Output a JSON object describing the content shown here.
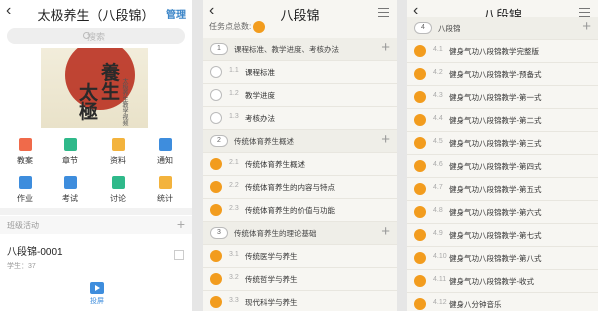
{
  "p1": {
    "title": "太极养生（八段锦）",
    "manage": "管理",
    "search_placeholder": "搜索",
    "cover": {
      "c1": "太\n極",
      "c2": "養\n生",
      "c3": "太极养生教学视频"
    },
    "grid": [
      {
        "label": "教案",
        "color": "#f06a4a"
      },
      {
        "label": "章节",
        "color": "#2fb98a"
      },
      {
        "label": "资料",
        "color": "#f3b33d"
      },
      {
        "label": "通知",
        "color": "#3e8ddd"
      },
      {
        "label": "作业",
        "color": "#3e8ddd"
      },
      {
        "label": "考试",
        "color": "#3e8ddd"
      },
      {
        "label": "讨论",
        "color": "#2fb98a"
      },
      {
        "label": "统计",
        "color": "#f3b33d"
      }
    ],
    "section": "班级活动",
    "class_name": "八段锦-0001",
    "students": "学生：37",
    "projection": "投屏"
  },
  "p2": {
    "title": "八段锦",
    "tasks_label": "任务点总数:",
    "rows": [
      {
        "type": "chapter",
        "num": "1",
        "text": "课程标准、教学进度、考核办法"
      },
      {
        "type": "lesson",
        "num": "1.1",
        "text": "课程标准",
        "dot": "empty"
      },
      {
        "type": "lesson",
        "num": "1.2",
        "text": "教学进度",
        "dot": "empty"
      },
      {
        "type": "lesson",
        "num": "1.3",
        "text": "考核办法",
        "dot": "empty"
      },
      {
        "type": "chapter",
        "num": "2",
        "text": "传统体育养生概述"
      },
      {
        "type": "lesson",
        "num": "2.1",
        "text": "传统体育养生概述",
        "dot": "orange"
      },
      {
        "type": "lesson",
        "num": "2.2",
        "text": "传统体育养生的内容与特点",
        "dot": "orange"
      },
      {
        "type": "lesson",
        "num": "2.3",
        "text": "传统体育养生的价值与功能",
        "dot": "orange"
      },
      {
        "type": "chapter",
        "num": "3",
        "text": "传统体育养生的理论基础"
      },
      {
        "type": "lesson",
        "num": "3.1",
        "text": "传统医学与养生",
        "dot": "orange"
      },
      {
        "type": "lesson",
        "num": "3.2",
        "text": "传统哲学与养生",
        "dot": "orange"
      },
      {
        "type": "lesson",
        "num": "3.3",
        "text": "现代科学与养生",
        "dot": "orange"
      }
    ]
  },
  "p3": {
    "title": "八段锦",
    "rows": [
      {
        "type": "chapter",
        "num": "4",
        "text": "八段锦"
      },
      {
        "type": "lesson",
        "num": "4.1",
        "text": "健身气功八段锦教学完整版",
        "dot": "orange"
      },
      {
        "type": "lesson",
        "num": "4.2",
        "text": "健身气功八段锦教学-预备式",
        "dot": "orange"
      },
      {
        "type": "lesson",
        "num": "4.3",
        "text": "健身气功八段锦教学-第一式",
        "dot": "orange"
      },
      {
        "type": "lesson",
        "num": "4.4",
        "text": "健身气功八段锦教学-第二式",
        "dot": "orange"
      },
      {
        "type": "lesson",
        "num": "4.5",
        "text": "健身气功八段锦教学-第三式",
        "dot": "orange"
      },
      {
        "type": "lesson",
        "num": "4.6",
        "text": "健身气功八段锦教学-第四式",
        "dot": "orange"
      },
      {
        "type": "lesson",
        "num": "4.7",
        "text": "健身气功八段锦教学-第五式",
        "dot": "orange"
      },
      {
        "type": "lesson",
        "num": "4.8",
        "text": "健身气功八段锦教学-第六式",
        "dot": "orange"
      },
      {
        "type": "lesson",
        "num": "4.9",
        "text": "健身气功八段锦教学-第七式",
        "dot": "orange"
      },
      {
        "type": "lesson",
        "num": "4.10",
        "text": "健身气功八段锦教学-第八式",
        "dot": "orange"
      },
      {
        "type": "lesson",
        "num": "4.11",
        "text": "健身气功八段锦教学-收式",
        "dot": "orange"
      },
      {
        "type": "lesson",
        "num": "4.12",
        "text": "健身八分钟音乐",
        "dot": "orange"
      }
    ]
  }
}
